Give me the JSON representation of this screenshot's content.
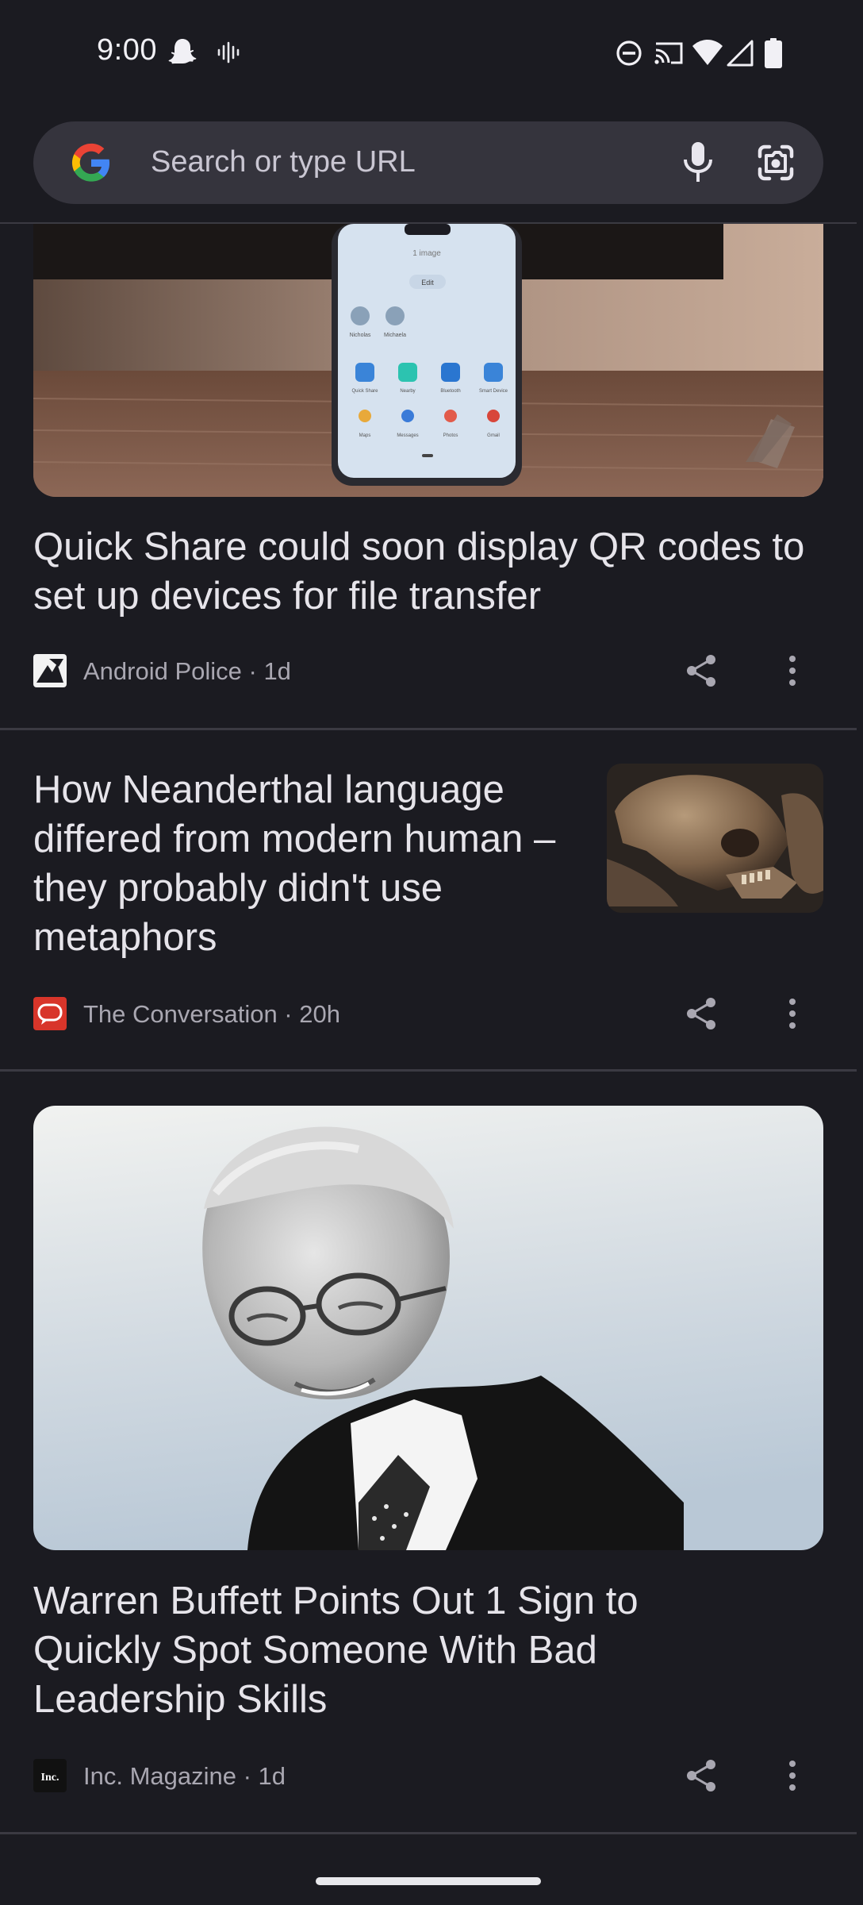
{
  "status_bar": {
    "time": "9:00",
    "icons": [
      "snapchat-ghost-icon",
      "sound-wave-icon",
      "do-not-disturb-icon",
      "cast-icon",
      "wifi-icon",
      "cell-signal-icon",
      "battery-icon"
    ]
  },
  "search": {
    "placeholder": "Search or type URL",
    "icons": [
      "google-logo",
      "mic-icon",
      "google-lens-icon"
    ]
  },
  "articles": [
    {
      "title": "Quick Share could soon display QR codes to set up devices for file transfer",
      "source": "Android Police",
      "age": "1d",
      "meta": "Android Police · 1d",
      "image": "phone showing quick share sheet on wooden table",
      "image_text": [
        "1 image",
        "Edit",
        "Nicholas",
        "Michaela",
        "Quick Share",
        "Nearby",
        "Bluetooth",
        "Smart Device",
        "Maps",
        "Messages",
        "Photos",
        "Gmail"
      ]
    },
    {
      "title": "How Neanderthal language differed from modern human – they probably didn't use metaphors",
      "source": "The Conversation",
      "age": "20h",
      "meta": "The Conversation · 20h",
      "image": "skull thumbnail"
    },
    {
      "title": "Warren Buffett Points Out 1 Sign to Quickly Spot Someone With Bad Leadership Skills",
      "source": "Inc. Magazine",
      "age": "1d",
      "meta": "Inc. Magazine · 1d",
      "image": "black and white portrait of elderly man in glasses",
      "logo_text": "Inc."
    }
  ],
  "colors": {
    "background": "#1b1b21",
    "search_bar": "#35343d",
    "title_text": "#e6e4ea",
    "meta_text": "#a9a7b1",
    "divider": "#3b3a42"
  }
}
